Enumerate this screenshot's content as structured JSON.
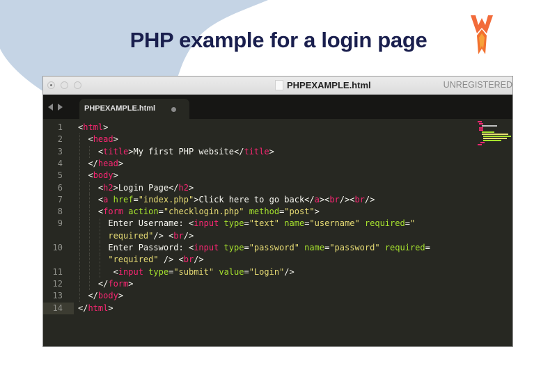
{
  "page": {
    "title": "PHP example for a login page",
    "logo": "wp-rocket-logo"
  },
  "window": {
    "title": "PHPEXAMPLE.html",
    "status_text": "UNREGISTERED",
    "tab": {
      "label": "PHPEXAMPLE.html",
      "modified": true
    }
  },
  "colors": {
    "tag": "#f92672",
    "attribute": "#a6e22e",
    "string": "#e6db74",
    "text": "#f8f8f2",
    "background": "#272822",
    "title": "#1a1f4e",
    "blob": "#c5d4e5"
  },
  "code": {
    "active_line": 14,
    "lines": [
      {
        "n": "1",
        "indent": 0,
        "tokens": [
          [
            "p",
            "<"
          ],
          [
            "t",
            "html"
          ],
          [
            "p",
            ">"
          ]
        ]
      },
      {
        "n": "2",
        "indent": 1,
        "tokens": [
          [
            "p",
            "<"
          ],
          [
            "t",
            "head"
          ],
          [
            "p",
            ">"
          ]
        ]
      },
      {
        "n": "3",
        "indent": 2,
        "tokens": [
          [
            "p",
            "<"
          ],
          [
            "t",
            "title"
          ],
          [
            "p",
            ">My first PHP website</"
          ],
          [
            "t",
            "title"
          ],
          [
            "p",
            ">"
          ]
        ]
      },
      {
        "n": "4",
        "indent": 1,
        "tokens": [
          [
            "p",
            "</"
          ],
          [
            "t",
            "head"
          ],
          [
            "p",
            ">"
          ]
        ]
      },
      {
        "n": "5",
        "indent": 1,
        "tokens": [
          [
            "p",
            "<"
          ],
          [
            "t",
            "body"
          ],
          [
            "p",
            ">"
          ]
        ]
      },
      {
        "n": "6",
        "indent": 2,
        "tokens": [
          [
            "p",
            "<"
          ],
          [
            "t",
            "h2"
          ],
          [
            "p",
            ">Login Page</"
          ],
          [
            "t",
            "h2"
          ],
          [
            "p",
            ">"
          ]
        ]
      },
      {
        "n": "7",
        "indent": 2,
        "tokens": [
          [
            "p",
            "<"
          ],
          [
            "t",
            "a"
          ],
          [
            "p",
            " "
          ],
          [
            "a",
            "href"
          ],
          [
            "p",
            "="
          ],
          [
            "s",
            "\"index.php\""
          ],
          [
            "p",
            ">Click here to go back</"
          ],
          [
            "t",
            "a"
          ],
          [
            "p",
            "><"
          ],
          [
            "t",
            "br"
          ],
          [
            "p",
            "/><"
          ],
          [
            "t",
            "br"
          ],
          [
            "p",
            "/>"
          ]
        ]
      },
      {
        "n": "8",
        "indent": 2,
        "tokens": [
          [
            "p",
            "<"
          ],
          [
            "t",
            "form"
          ],
          [
            "p",
            " "
          ],
          [
            "a",
            "action"
          ],
          [
            "p",
            "="
          ],
          [
            "s",
            "\"checklogin.php\""
          ],
          [
            "p",
            " "
          ],
          [
            "a",
            "method"
          ],
          [
            "p",
            "="
          ],
          [
            "s",
            "\"post\""
          ],
          [
            "p",
            ">"
          ]
        ]
      },
      {
        "n": "9",
        "indent": 3,
        "tokens": [
          [
            "p",
            "Enter Username: <"
          ],
          [
            "t",
            "input"
          ],
          [
            "p",
            " "
          ],
          [
            "a",
            "type"
          ],
          [
            "p",
            "="
          ],
          [
            "s",
            "\"text\""
          ],
          [
            "p",
            " "
          ],
          [
            "a",
            "name"
          ],
          [
            "p",
            "="
          ],
          [
            "s",
            "\"username\""
          ],
          [
            "p",
            " "
          ],
          [
            "a",
            "required"
          ],
          [
            "p",
            "="
          ],
          [
            "s",
            "\""
          ]
        ]
      },
      {
        "n": "",
        "indent": 3,
        "tokens": [
          [
            "s",
            "required\""
          ],
          [
            "p",
            "/> <"
          ],
          [
            "t",
            "br"
          ],
          [
            "p",
            "/>"
          ]
        ]
      },
      {
        "n": "10",
        "indent": 3,
        "tokens": [
          [
            "p",
            "Enter Password: <"
          ],
          [
            "t",
            "input"
          ],
          [
            "p",
            " "
          ],
          [
            "a",
            "type"
          ],
          [
            "p",
            "="
          ],
          [
            "s",
            "\"password\""
          ],
          [
            "p",
            " "
          ],
          [
            "a",
            "name"
          ],
          [
            "p",
            "="
          ],
          [
            "s",
            "\"password\""
          ],
          [
            "p",
            " "
          ],
          [
            "a",
            "required"
          ],
          [
            "p",
            "="
          ]
        ]
      },
      {
        "n": "",
        "indent": 3,
        "tokens": [
          [
            "s",
            "\"required\""
          ],
          [
            "p",
            " /> <"
          ],
          [
            "t",
            "br"
          ],
          [
            "p",
            "/>"
          ]
        ]
      },
      {
        "n": "11",
        "indent": 3,
        "tokens": [
          [
            "p",
            " <"
          ],
          [
            "t",
            "input"
          ],
          [
            "p",
            " "
          ],
          [
            "a",
            "type"
          ],
          [
            "p",
            "="
          ],
          [
            "s",
            "\"submit\""
          ],
          [
            "p",
            " "
          ],
          [
            "a",
            "value"
          ],
          [
            "p",
            "="
          ],
          [
            "s",
            "\"Login\""
          ],
          [
            "p",
            "/>"
          ]
        ]
      },
      {
        "n": "12",
        "indent": 2,
        "tokens": [
          [
            "p",
            "</"
          ],
          [
            "t",
            "form"
          ],
          [
            "p",
            ">"
          ]
        ]
      },
      {
        "n": "13",
        "indent": 1,
        "tokens": [
          [
            "p",
            "</"
          ],
          [
            "t",
            "body"
          ],
          [
            "p",
            ">"
          ]
        ]
      },
      {
        "n": "14",
        "indent": 0,
        "tokens": [
          [
            "p",
            "</"
          ],
          [
            "t",
            "html"
          ],
          [
            "p",
            ">"
          ]
        ]
      }
    ]
  }
}
